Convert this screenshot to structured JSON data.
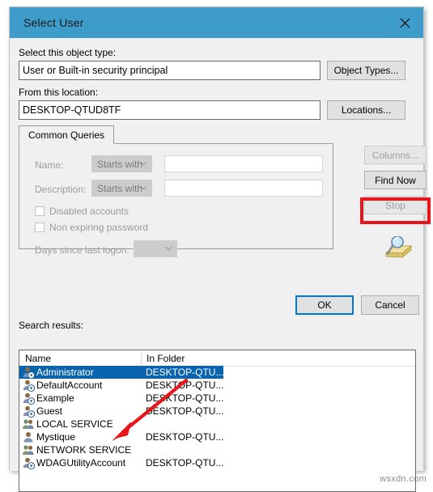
{
  "window": {
    "title": "Select User",
    "close_icon": "close-icon",
    "titlebar_color": "#3d9cc9"
  },
  "object_type": {
    "label": "Select this object type:",
    "value": "User or Built-in security principal",
    "button": "Object Types..."
  },
  "location": {
    "label": "From this location:",
    "value": "DESKTOP-QTUD8TF",
    "button": "Locations..."
  },
  "tabs": [
    {
      "label": "Common Queries",
      "selected": true
    }
  ],
  "query": {
    "name_label": "Name:",
    "name_operator": "Starts with",
    "name_value": "",
    "description_label": "Description:",
    "description_operator": "Starts with",
    "description_value": "",
    "disabled_accounts_label": "Disabled accounts",
    "disabled_accounts_checked": false,
    "non_expiring_password_label": "Non expiring password",
    "non_expiring_password_checked": false,
    "days_since_logon_label": "Days since last logon:",
    "days_since_logon_value": ""
  },
  "side_buttons": {
    "columns": "Columns...",
    "find_now": "Find Now",
    "stop": "Stop",
    "search_icon": "magnifier-folder-icon",
    "highlight_color": "#e8151b"
  },
  "dialog_buttons": {
    "ok": "OK",
    "cancel": "Cancel"
  },
  "results": {
    "label": "Search results:",
    "columns": [
      "Name",
      "In Folder"
    ],
    "rows": [
      {
        "name": "Administrator",
        "folder": "DESKTOP-QTU...",
        "icon": "user-builtin-icon",
        "selected": true
      },
      {
        "name": "DefaultAccount",
        "folder": "DESKTOP-QTU...",
        "icon": "user-builtin-icon",
        "selected": false
      },
      {
        "name": "Example",
        "folder": "DESKTOP-QTU...",
        "icon": "user-builtin-icon",
        "selected": false
      },
      {
        "name": "Guest",
        "folder": "DESKTOP-QTU...",
        "icon": "user-builtin-icon",
        "selected": false
      },
      {
        "name": "LOCAL SERVICE",
        "folder": "",
        "icon": "group-icon",
        "selected": false
      },
      {
        "name": "Mystique",
        "folder": "DESKTOP-QTU...",
        "icon": "user-icon",
        "selected": false
      },
      {
        "name": "NETWORK SERVICE",
        "folder": "",
        "icon": "group-icon",
        "selected": false
      },
      {
        "name": "WDAGUtilityAccount",
        "folder": "DESKTOP-QTU...",
        "icon": "user-builtin-icon",
        "selected": false
      }
    ]
  },
  "annotation": {
    "arrow_color": "#e8151b",
    "arrow_name": "red-pointer-arrow"
  },
  "watermark": "wsxdn.com"
}
